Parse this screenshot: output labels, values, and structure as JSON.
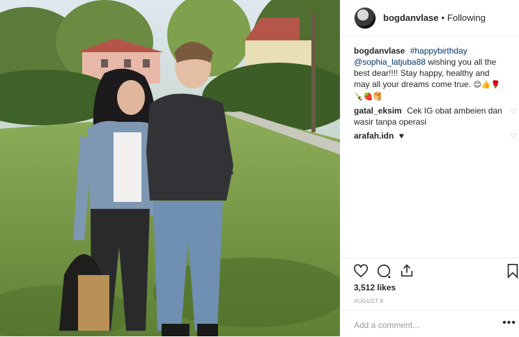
{
  "header": {
    "username": "bogdanvlase",
    "dot": "•",
    "follow_status": "Following"
  },
  "caption": {
    "username": "bogdanvlase",
    "hashtag": "#happybirthday",
    "mention": "@sophia_latjuba88",
    "text": "wishing you all the best dear!!!! Stay happy, healthy and may all your dreams come true.",
    "emojis": "😊👍🌹🍾🍓🥞"
  },
  "comments": [
    {
      "username": "gatal_eksim",
      "text": "Cek IG obat ambeien dan wasir tanpa operasi"
    },
    {
      "username": "arafah.idn",
      "text": "♥"
    }
  ],
  "like_icon": "heart-outline-icon",
  "likes": "3,512 likes",
  "date": "AUGUST 8",
  "add_comment_placeholder": "Add a comment...",
  "more_options": "•••",
  "colors": {
    "link": "#003569",
    "text": "#262626",
    "muted": "#999999",
    "divider": "#efefef"
  }
}
